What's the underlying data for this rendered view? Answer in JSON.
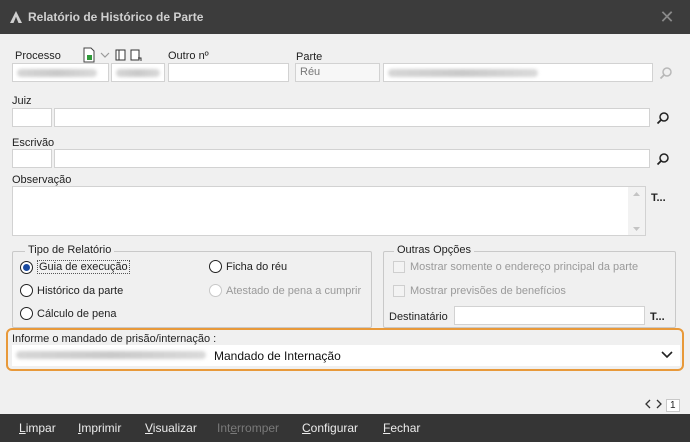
{
  "window": {
    "title": "Relatório de Histórico de Parte",
    "close_glyph": "✕"
  },
  "processo": {
    "label": "Processo",
    "outro_label": "Outro nº",
    "parte_label": "Parte",
    "parte_tipo": "Réu"
  },
  "juiz": {
    "label": "Juiz"
  },
  "escrivao": {
    "label": "Escrivão"
  },
  "observacao": {
    "label": "Observação",
    "side_btn": "T..."
  },
  "tipo_relatorio": {
    "title": "Tipo de Relatório",
    "options": [
      {
        "label": "Guia de execução",
        "selected": true,
        "enabled": true
      },
      {
        "label": "Ficha do réu",
        "selected": false,
        "enabled": true
      },
      {
        "label": "Histórico da parte",
        "selected": false,
        "enabled": true
      },
      {
        "label": "Atestado de pena a cumprir",
        "selected": false,
        "enabled": false
      },
      {
        "label": "Cálculo de pena",
        "selected": false,
        "enabled": true
      }
    ]
  },
  "outras_opcoes": {
    "title": "Outras Opções",
    "checks": [
      {
        "label": "Mostrar somente o endereço principal da parte"
      },
      {
        "label": "Mostrar previsões de benefícios"
      }
    ],
    "destinatario_label": "Destinatário",
    "destinatario_btn": "T..."
  },
  "mandado": {
    "label": "Informe o mandado de prisão/internação :",
    "selected": "Mandado de Internação"
  },
  "pager": {
    "page": "1"
  },
  "toolbar": {
    "limpar": "Limpar",
    "imprimir": "Imprimir",
    "visualizar": "Visualizar",
    "interromper": "Interromper",
    "configurar": "Configurar",
    "fechar": "Fechar"
  },
  "colors": {
    "titlebar": "#3c3c3c",
    "toolbar": "#353535",
    "highlight": "#e8993a",
    "radio_dot": "#1a4aa0"
  }
}
